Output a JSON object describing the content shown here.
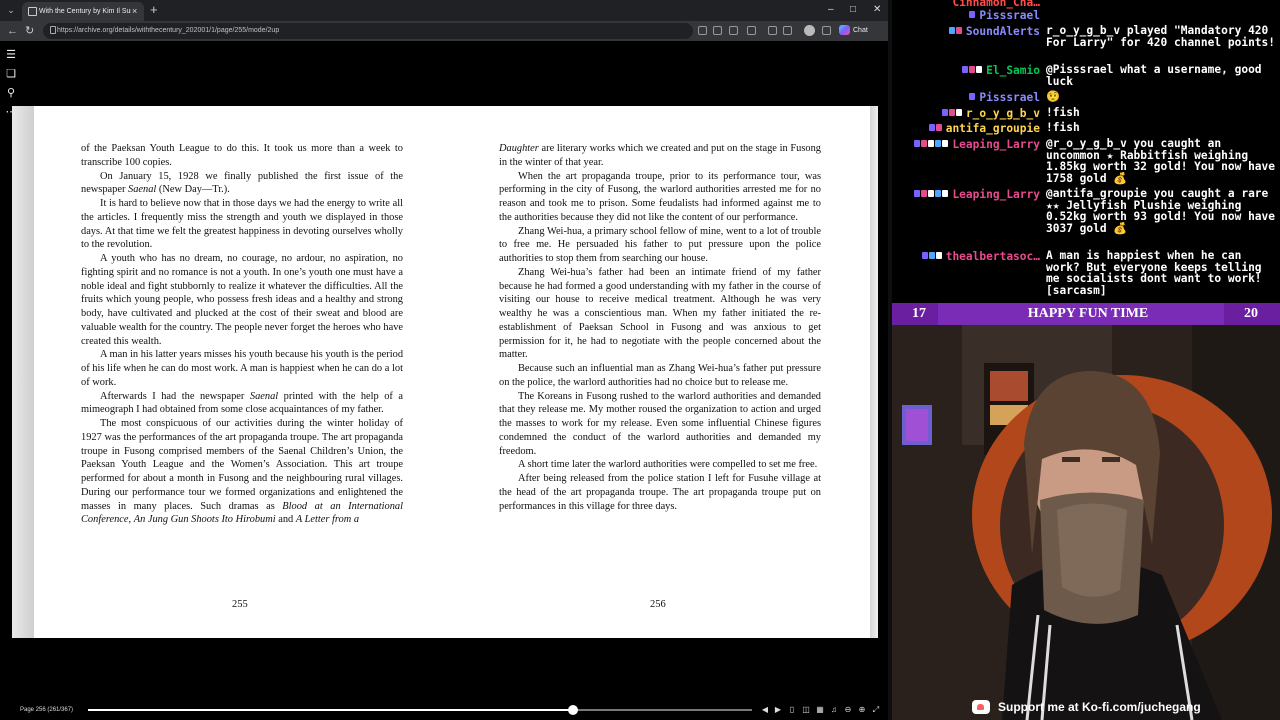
{
  "browser": {
    "tab_title": "With the Century by Kim Il Sung (…",
    "url": "https://archive.org/details/withthecentury_202001/1/page/255/mode/2up",
    "chat_button_label": "Chat",
    "new_tab_symbol": "+",
    "close_tab_symbol": "×"
  },
  "reader": {
    "left_page_number": "255",
    "right_page_number": "256",
    "page_info": "Page 256 (261/367)",
    "progress_fraction": 0.73
  },
  "chat": {
    "messages": [
      {
        "user": "Cinnamon_Cha…",
        "color": "#ff4d4d",
        "text": "",
        "badges": []
      },
      {
        "user": "Pisssrael",
        "color": "#8a8aff",
        "text": "",
        "badges": [
          "#7b61ff"
        ]
      },
      {
        "user": "SoundAlerts",
        "color": "#8a8aff",
        "text": "r_o_y_g_b_v played \"Mandatory 420 For Larry\" for 420 channel points!",
        "badges": [
          "#4aa8ff",
          "#e64b8d"
        ]
      },
      {
        "user": "El_Samio",
        "color": "#00c853",
        "text": "@Pisssrael what a username, good luck",
        "badges": [
          "#7b61ff",
          "#e64b8d",
          "#ffffff"
        ]
      },
      {
        "user": "Pisssrael",
        "color": "#8a8aff",
        "text": "🤨",
        "badges": [
          "#7b61ff"
        ]
      },
      {
        "user": "r_o_y_g_b_v",
        "color": "#ffd54f",
        "text": "!fish",
        "badges": [
          "#7b61ff",
          "#e64b8d",
          "#ffffff"
        ]
      },
      {
        "user": "antifa_groupie",
        "color": "#ffd54f",
        "text": "!fish",
        "badges": [
          "#7b61ff",
          "#e64b8d"
        ]
      },
      {
        "user": "Leaping_Larry",
        "color": "#e64b8d",
        "text": "@r_o_y_g_b_v you caught an uncommon ★ Rabbitfish weighing 1.85kg worth 32 gold! You now have 1758 gold 💰",
        "badges": [
          "#7b61ff",
          "#e64b8d",
          "#ffffff",
          "#4aa8ff",
          "#ffffff"
        ]
      },
      {
        "user": "Leaping_Larry",
        "color": "#e64b8d",
        "text": "@antifa_groupie you caught a rare ★★ Jellyfish Plushie weighing 0.52kg worth 93 gold! You now have 3037 gold 💰",
        "badges": [
          "#7b61ff",
          "#e64b8d",
          "#ffffff",
          "#4aa8ff",
          "#ffffff"
        ]
      },
      {
        "user": "thealbertasoc…",
        "color": "#e64b8d",
        "text": "A man is happiest when he can work? But everyone keeps telling me socialists dont want to work! [sarcasm]",
        "badges": [
          "#7b61ff",
          "#4aa8ff",
          "#ffffff"
        ]
      }
    ]
  },
  "overlay": {
    "left_number": "17",
    "title": "HAPPY FUN TIME",
    "right_number": "20",
    "kofi_text": "Support me at Ko-fi.com/juchegang"
  }
}
